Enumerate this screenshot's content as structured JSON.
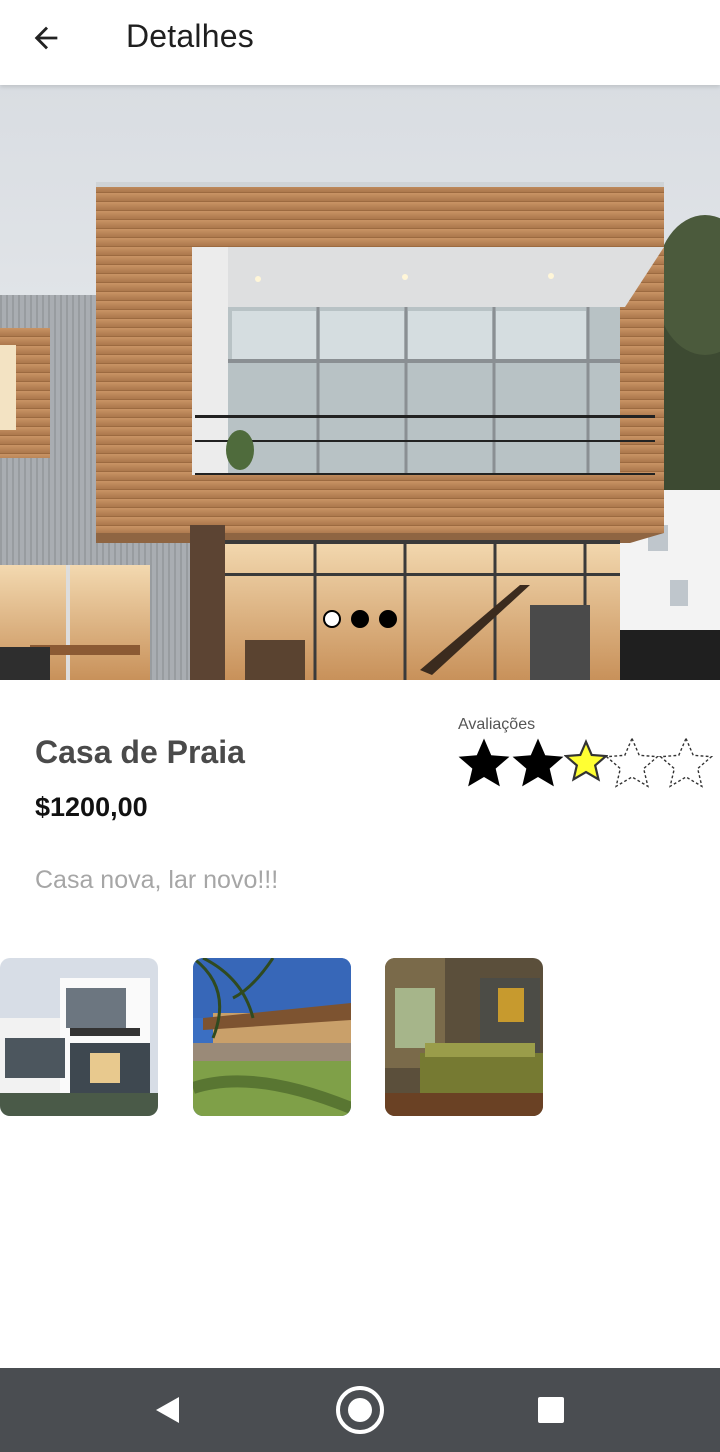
{
  "appbar": {
    "title": "Detalhes",
    "back_icon": "arrow-left-icon"
  },
  "hero": {
    "image": "modern-house-photo",
    "carousel": {
      "count": 3,
      "active_index": 0
    }
  },
  "property": {
    "title": "Casa de Praia",
    "price": "$1200,00",
    "description": "Casa nova, lar novo!!!"
  },
  "rating": {
    "label": "Avaliações",
    "value": 2.5,
    "max": 5,
    "colors": {
      "filled": "#000000",
      "half": "#ffff33",
      "empty_outline": "#333333"
    }
  },
  "thumbnails": [
    {
      "image": "white-modern-house-thumbnail"
    },
    {
      "image": "beach-house-palm-thumbnail"
    },
    {
      "image": "bedroom-interior-thumbnail"
    }
  ],
  "navbar": {
    "back_icon": "nav-back-icon",
    "home_icon": "nav-home-icon",
    "recents_icon": "nav-recents-icon"
  }
}
